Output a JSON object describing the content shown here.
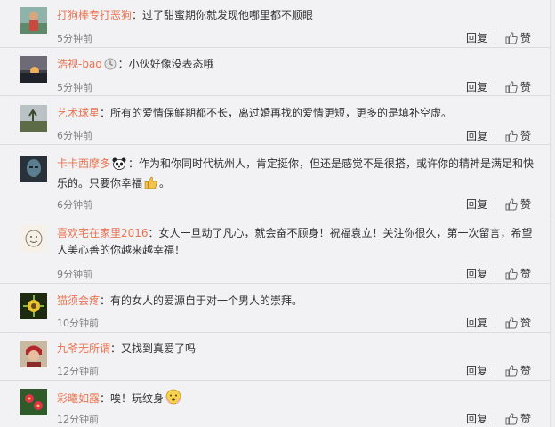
{
  "comments": [
    {
      "author": "打狗棒专打恶狗",
      "text": "：过了甜蜜期你就发现他哪里都不顺眼",
      "time": "5分钟前",
      "avatar_icon": "avatar-figure",
      "reply": "回复",
      "like": "赞"
    },
    {
      "author": "浩视-bao",
      "badge_icon": "clock-badge-icon",
      "text": "：小伙好像没表态哦",
      "time": "5分钟前",
      "avatar_icon": "avatar-sunset",
      "reply": "回复",
      "like": "赞"
    },
    {
      "author": "艺术球星",
      "text": "：所有的爱情保鲜期都不长，离过婚再找的爱情更短，更多的是填补空虚。",
      "time": "6分钟前",
      "avatar_icon": "avatar-field",
      "reply": "回复",
      "like": "赞"
    },
    {
      "author": "卡卡西摩多",
      "badge_icon": "panda-icon",
      "text": "：作为和你同时代杭州人，肯定挺你，但还是感觉不是很搭，或许你的精神是满足和快乐的。只要你幸福",
      "trail_icon": "thumbs-up-emoji-icon",
      "trail_text": "。",
      "time": "6分钟前",
      "avatar_icon": "avatar-statue",
      "reply": "回复",
      "like": "赞"
    },
    {
      "author": "喜欢宅在家里2016",
      "text": "：女人一旦动了凡心，就会奋不顾身！祝福袁立！关注你很久，第一次留言，希望人美心善的你越来越幸福！",
      "time": "9分钟前",
      "avatar_icon": "avatar-sketch",
      "reply": "回复",
      "like": "赞"
    },
    {
      "author": "猫须会疼",
      "text": "：有的女人的爱源自于对一个男人的崇拜。",
      "time": "10分钟前",
      "avatar_icon": "avatar-firework",
      "reply": "回复",
      "like": "赞"
    },
    {
      "author": "九爷无所谓",
      "text": "：又找到真爱了吗",
      "time": "12分钟前",
      "avatar_icon": "avatar-portrait",
      "reply": "回复",
      "like": "赞"
    },
    {
      "author": "彩曦如露",
      "text": "：唉！玩纹身",
      "trail_icon": "face-emoji-icon",
      "time": "12分钟前",
      "avatar_icon": "avatar-flower",
      "reply": "回复",
      "like": "赞"
    }
  ]
}
